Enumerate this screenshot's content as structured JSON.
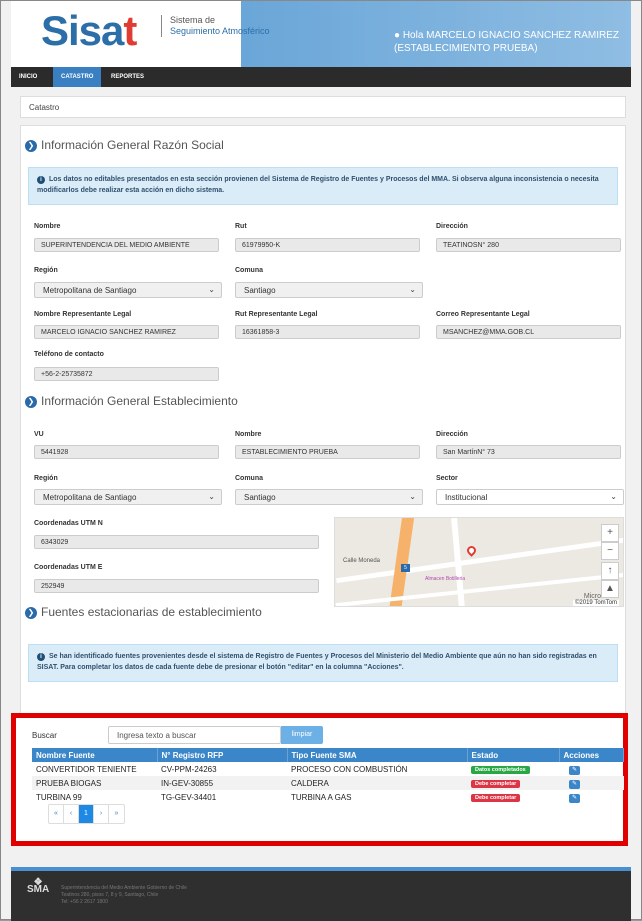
{
  "header": {
    "logo_main": "Sisa",
    "logo_t": "t",
    "logo_sub1": "Sistema de",
    "logo_sub2": "Seguimiento Atmosférico",
    "user_line1": "Hola MARCELO IGNACIO SANCHEZ RAMIREZ",
    "user_line2": "(ESTABLECIMIENTO PRUEBA)"
  },
  "nav": {
    "items": [
      "INICIO",
      "CATASTRO",
      "REPORTES"
    ],
    "active": "CATASTRO"
  },
  "breadcrumb": "Catastro",
  "razon_social": {
    "title": "Información General Razón Social",
    "info": "Los datos no editables presentados en esta sección provienen del Sistema de Registro de Fuentes y Procesos del MMA. Si observa alguna inconsistencia o necesita modificarlos debe realizar esta acción en dicho sistema.",
    "nombre_label": "Nombre",
    "nombre": "SUPERINTENDENCIA DEL MEDIO AMBIENTE",
    "rut_label": "Rut",
    "rut": "61979950-K",
    "direccion_label": "Dirección",
    "direccion": "TEATINOSN° 280",
    "region_label": "Región",
    "region": "Metropolitana de Santiago",
    "comuna_label": "Comuna",
    "comuna": "Santiago",
    "rep_label": "Nombre Representante Legal",
    "rep": "MARCELO IGNACIO SANCHEZ RAMIREZ",
    "rut_rep_label": "Rut Representante Legal",
    "rut_rep": "16361858-3",
    "correo_label": "Correo Representante Legal",
    "correo": "MSANCHEZ@MMA.GOB.CL",
    "tel_label": "Teléfono de contacto",
    "tel": "+56-2-25735872"
  },
  "establecimiento": {
    "title": "Información General Establecimiento",
    "vu_label": "VU",
    "vu": "5441928",
    "nombre_label": "Nombre",
    "nombre": "ESTABLECIMIENTO PRUEBA",
    "direccion_label": "Dirección",
    "direccion": "San MartínN° 73",
    "region_label": "Región",
    "region": "Metropolitana de Santiago",
    "comuna_label": "Comuna",
    "comuna": "Santiago",
    "sector_label": "Sector",
    "sector": "Institucional",
    "utm_n_label": "Coordenadas UTM N",
    "utm_n": "6343029",
    "utm_e_label": "Coordenadas UTM E",
    "utm_e": "252949"
  },
  "map": {
    "street1": "Calle Moneda",
    "street2": "Almacen Botilleria",
    "badge1": "5",
    "attribution": "©2019 TomTom",
    "brand": "Micro"
  },
  "fuentes": {
    "title": "Fuentes estacionarias de establecimiento",
    "info": "Se han identificado fuentes provenientes desde el sistema de Registro de Fuentes y Procesos del Ministerio del Medio Ambiente que aún no han sido registradas en SISAT. Para completar los datos de cada fuente debe de presionar el botón \"editar\" en la columna \"Acciones\".",
    "search_label": "Buscar",
    "search_placeholder": "Ingresa texto a buscar",
    "clear_label": "limpiar",
    "columns": [
      "Nombre Fuente",
      "N° Registro RFP",
      "Tipo Fuente SMA",
      "Estado",
      "Acciones"
    ],
    "rows": [
      {
        "nombre": "CONVERTIDOR TENIENTE",
        "registro": "CV-PPM-24263",
        "tipo": "PROCESO CON COMBUSTIÓN",
        "estado": "Datos completados",
        "status": "ok"
      },
      {
        "nombre": "PRUEBA BIOGAS",
        "registro": "IN-GEV-30855",
        "tipo": "CALDERA",
        "estado": "Debe completar",
        "status": "bad"
      },
      {
        "nombre": "TURBINA 99",
        "registro": "TG-GEV-34401",
        "tipo": "TURBINA A GAS",
        "estado": "Debe completar",
        "status": "bad"
      }
    ],
    "pager": [
      "«",
      "‹",
      "1",
      "›",
      "»"
    ]
  },
  "footer": {
    "brand": "SMA",
    "line1": "Superintendencia del Medio Ambiente Gobierno de Chile",
    "line2": "Teatinos 280, pisos 7, 8 y 9, Santiago, Chile",
    "line3": "Tel: +56 2 2617 1800"
  },
  "colors": {
    "accent": "#3a86c8",
    "highlight": "#e10000",
    "ok": "#28a745",
    "bad": "#dc3545"
  }
}
